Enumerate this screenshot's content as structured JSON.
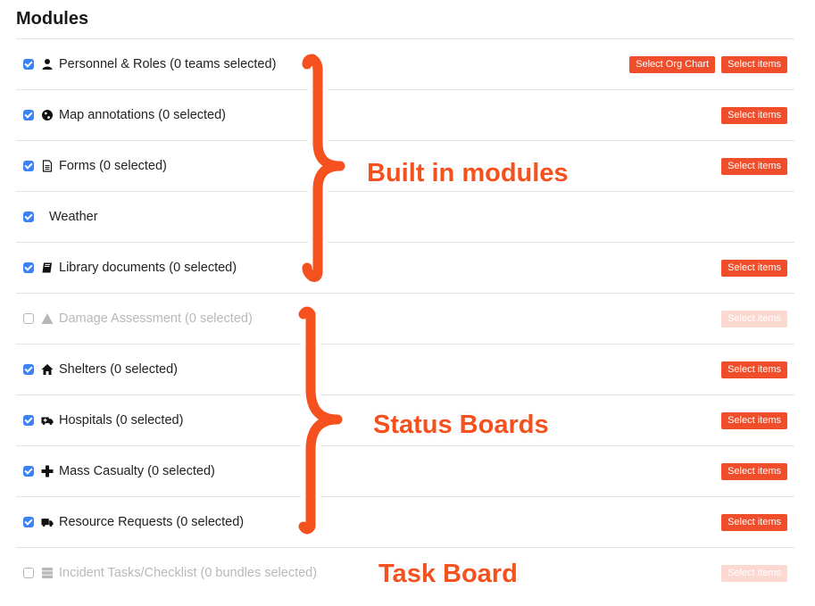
{
  "title": "Modules",
  "modules": [
    {
      "label": "Personnel & Roles (0 teams selected)",
      "checked": true,
      "disabled": false,
      "icon": "user-icon",
      "buttons": [
        "Select Org Chart",
        "Select items"
      ]
    },
    {
      "label": "Map annotations (0 selected)",
      "checked": true,
      "disabled": false,
      "icon": "globe-icon",
      "buttons": [
        "Select items"
      ]
    },
    {
      "label": "Forms (0 selected)",
      "checked": true,
      "disabled": false,
      "icon": "document-icon",
      "buttons": [
        "Select items"
      ]
    },
    {
      "label": "Weather",
      "checked": true,
      "disabled": false,
      "icon": "",
      "buttons": []
    },
    {
      "label": "Library documents (0 selected)",
      "checked": true,
      "disabled": false,
      "icon": "book-icon",
      "buttons": [
        "Select items"
      ]
    },
    {
      "label": "Damage Assessment (0 selected)",
      "checked": false,
      "disabled": true,
      "icon": "warning-icon",
      "buttons": [
        "Select items"
      ]
    },
    {
      "label": "Shelters (0 selected)",
      "checked": true,
      "disabled": false,
      "icon": "home-icon",
      "buttons": [
        "Select items"
      ]
    },
    {
      "label": "Hospitals (0 selected)",
      "checked": true,
      "disabled": false,
      "icon": "ambulance-icon",
      "buttons": [
        "Select items"
      ]
    },
    {
      "label": "Mass Casualty (0 selected)",
      "checked": true,
      "disabled": false,
      "icon": "plus-icon",
      "buttons": [
        "Select items"
      ]
    },
    {
      "label": "Resource Requests (0 selected)",
      "checked": true,
      "disabled": false,
      "icon": "truck-icon",
      "buttons": [
        "Select items"
      ]
    },
    {
      "label": "Incident Tasks/Checklist (0 bundles selected)",
      "checked": false,
      "disabled": true,
      "icon": "server-icon",
      "buttons": [
        "Select items"
      ]
    }
  ],
  "annotations": {
    "built_in": "Built in modules",
    "status_boards": "Status Boards",
    "task_board": "Task Board"
  },
  "colors": {
    "accent": "#f04d2a",
    "accent_faded": "#fbd9d1",
    "checkbox": "#3b82f6",
    "annotation": "#f4511e"
  }
}
